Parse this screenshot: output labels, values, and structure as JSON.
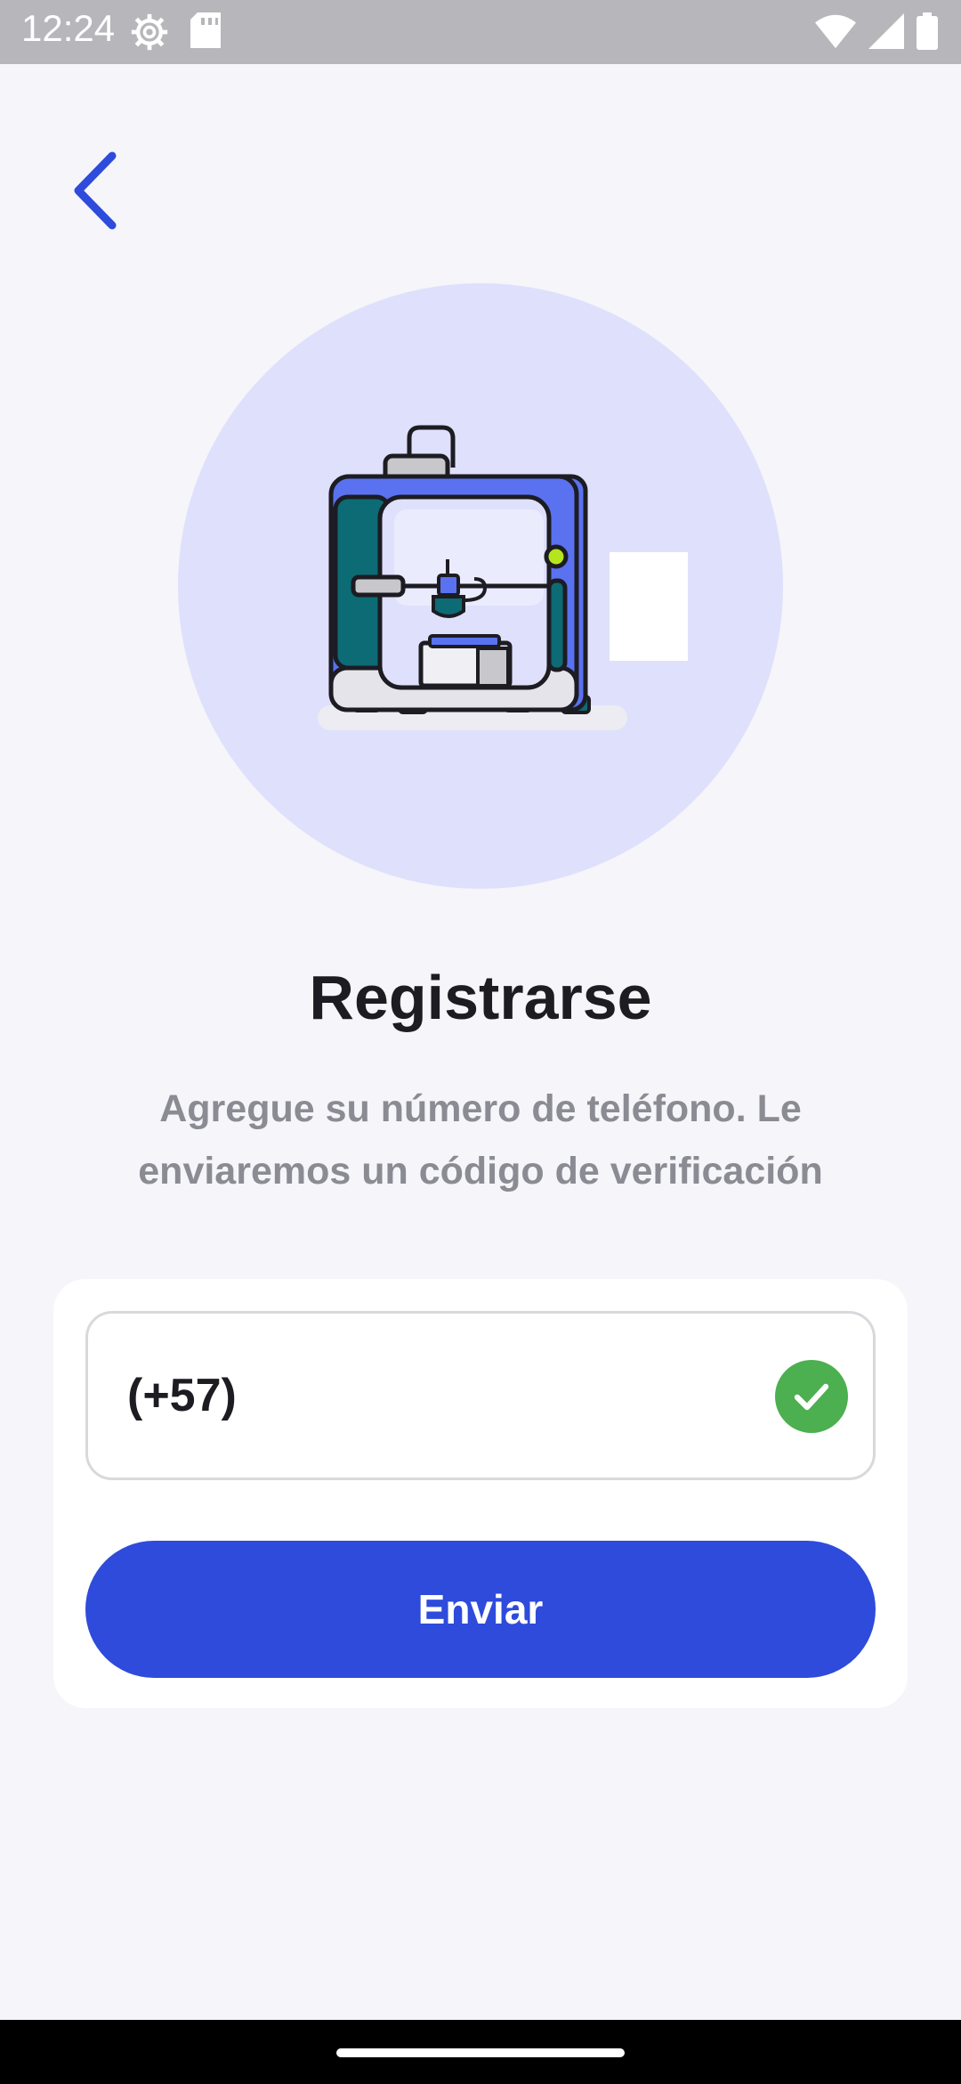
{
  "status_bar": {
    "time": "12:24",
    "icons": [
      "settings-icon",
      "sd-card-icon",
      "wifi-icon",
      "signal-icon",
      "battery-icon"
    ]
  },
  "header": {
    "back_icon": "chevron-left-icon"
  },
  "hero": {
    "illustration": "3d-printer-illustration"
  },
  "title": "Registrarse",
  "subtitle": "Agregue su número de teléfono. Le enviaremos un código de verificación",
  "form": {
    "phone_value": "(+57)",
    "valid_icon": "check-circle-icon",
    "submit_label": "Enviar"
  },
  "colors": {
    "accent": "#2e4bdb",
    "hero_bg": "#dfe0fc",
    "success": "#4caf50",
    "page_bg": "#f5f5fa"
  }
}
